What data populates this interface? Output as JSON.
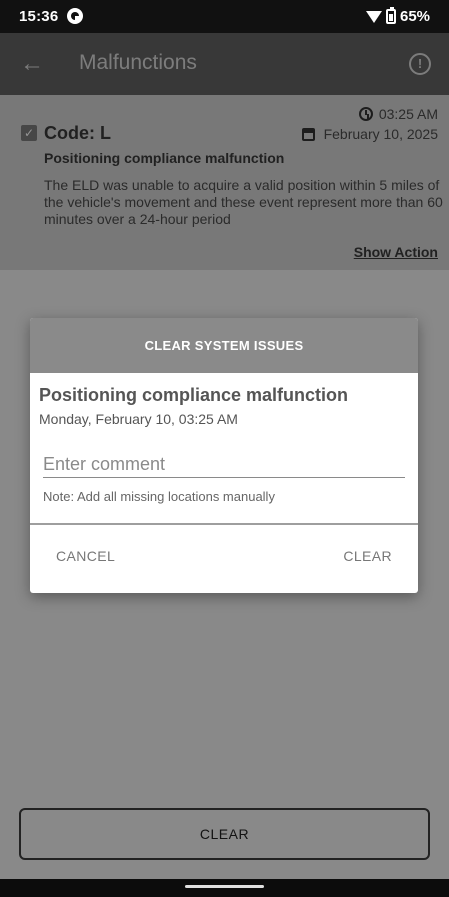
{
  "status_bar": {
    "time": "15:36",
    "battery": "65%"
  },
  "app_bar": {
    "title": "Malfunctions"
  },
  "malfunction": {
    "code": "Code: L",
    "time": "03:25 AM",
    "date": "February 10, 2025",
    "title": "Positioning compliance malfunction",
    "description": "The ELD was unable to acquire a valid position within 5 miles of the vehicle's movement and these event represent more than 60 minutes over a 24-hour period",
    "show_action": "Show Action"
  },
  "dialog": {
    "header": "CLEAR SYSTEM ISSUES",
    "title": "Positioning compliance malfunction",
    "datetime": "Monday, February 10, 03:25 AM",
    "comment_placeholder": "Enter comment",
    "comment_value": "",
    "note": "Note: Add all missing locations manually",
    "cancel_label": "CANCEL",
    "clear_label": "CLEAR"
  },
  "bottom": {
    "clear_label": "CLEAR"
  },
  "icons": {
    "back": "arrow-left-icon",
    "info": "info-circle-icon",
    "clock": "clock-icon",
    "calendar": "calendar-icon",
    "checkbox": "checkbox-checked-icon",
    "wifi": "wifi-icon",
    "battery": "battery-icon"
  },
  "colors": {
    "app_bar": "#616161",
    "card": "#cfcfcf",
    "dialog_header": "#8a8a8a",
    "status_bar": "#111111"
  }
}
